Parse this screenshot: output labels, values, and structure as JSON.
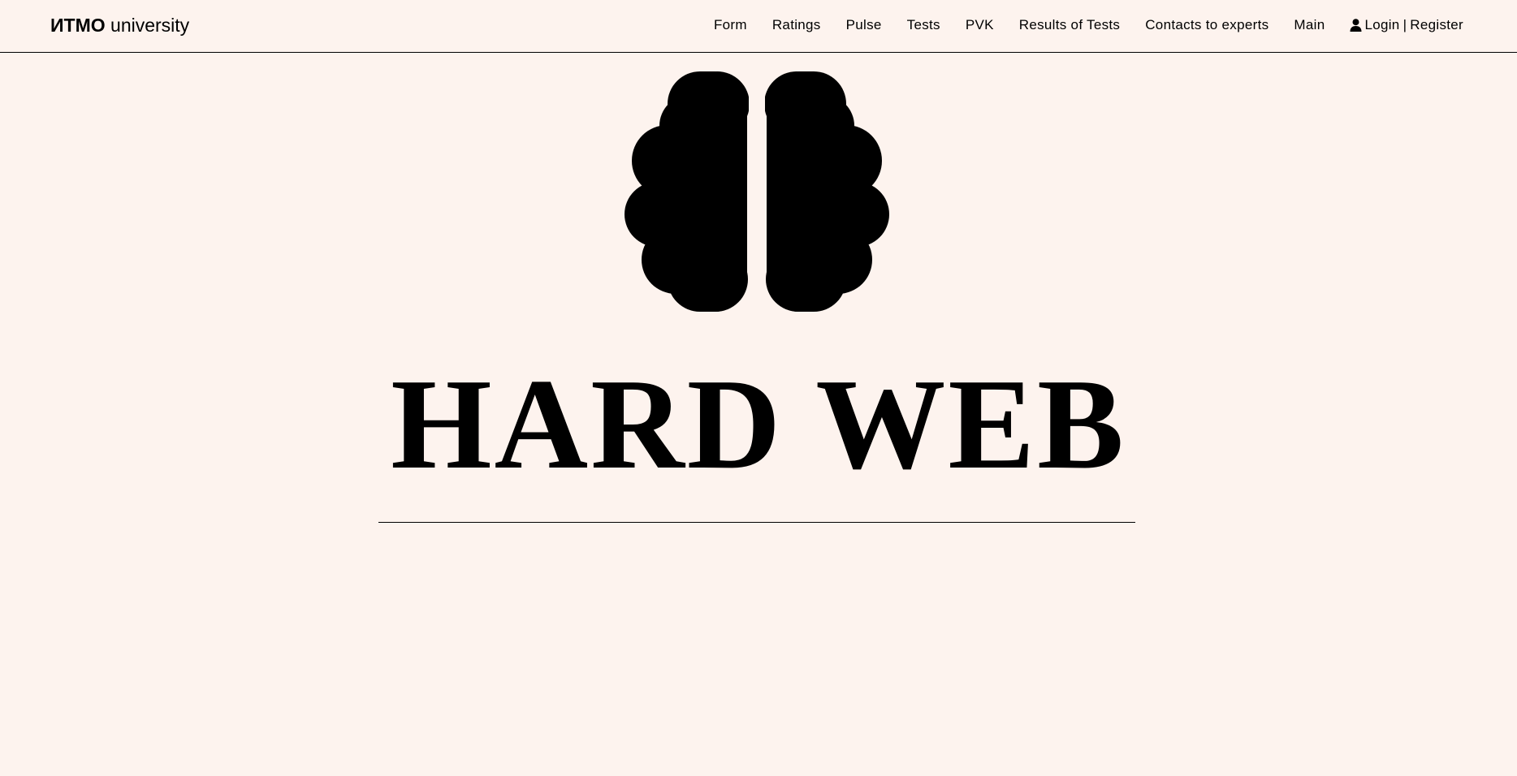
{
  "brand": {
    "bold": "ИТМО",
    "light": "university"
  },
  "nav": {
    "links": [
      "Form",
      "Ratings",
      "Pulse",
      "Tests",
      "PVK",
      "Results of Tests",
      "Contacts to experts",
      "Main"
    ],
    "login_label": "Login",
    "separator": "|",
    "register_label": "Register",
    "user_icon": "user-icon"
  },
  "hero": {
    "icon": "brain-icon",
    "title": "HARD WEB"
  },
  "colors": {
    "background": "#fdf3ee",
    "text": "#000000"
  }
}
